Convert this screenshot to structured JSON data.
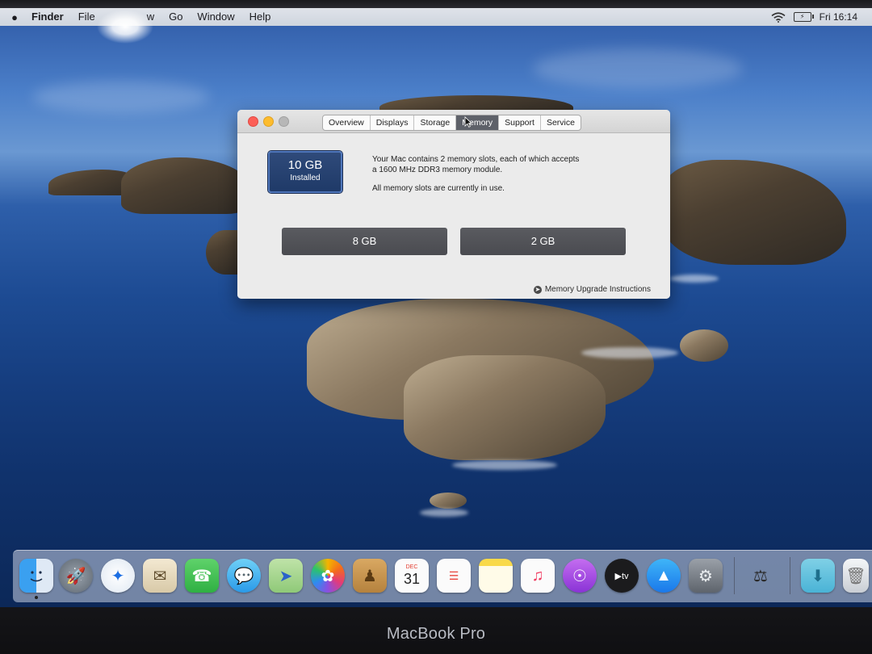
{
  "menubar": {
    "items": [
      "Finder",
      "File",
      "w",
      "Go",
      "Window",
      "Help"
    ],
    "clock": "Fri 16:14"
  },
  "window": {
    "tabs": [
      "Overview",
      "Displays",
      "Storage",
      "Memory",
      "Support",
      "Service"
    ],
    "active_tab": "Memory",
    "badge_size": "10 GB",
    "badge_label": "Installed",
    "info_line1": "Your Mac contains 2 memory slots, each of which accepts",
    "info_line2": "a 1600 MHz DDR3 memory module.",
    "info_line3": "All memory slots are currently in use.",
    "slots": [
      "8 GB",
      "2 GB"
    ],
    "upgrade_link": "Memory Upgrade Instructions"
  },
  "dock": {
    "calendar_month": "DEC",
    "calendar_day": "31",
    "apps": [
      "finder",
      "launchpad",
      "safari",
      "mail",
      "facetime",
      "messages",
      "maps",
      "photos",
      "contacts",
      "calendar",
      "reminders",
      "notes",
      "music",
      "podcasts",
      "tv",
      "app-store",
      "system-preferences",
      "system-information",
      "downloads",
      "trash"
    ]
  },
  "bezel": {
    "brand": "MacBook Pro"
  }
}
